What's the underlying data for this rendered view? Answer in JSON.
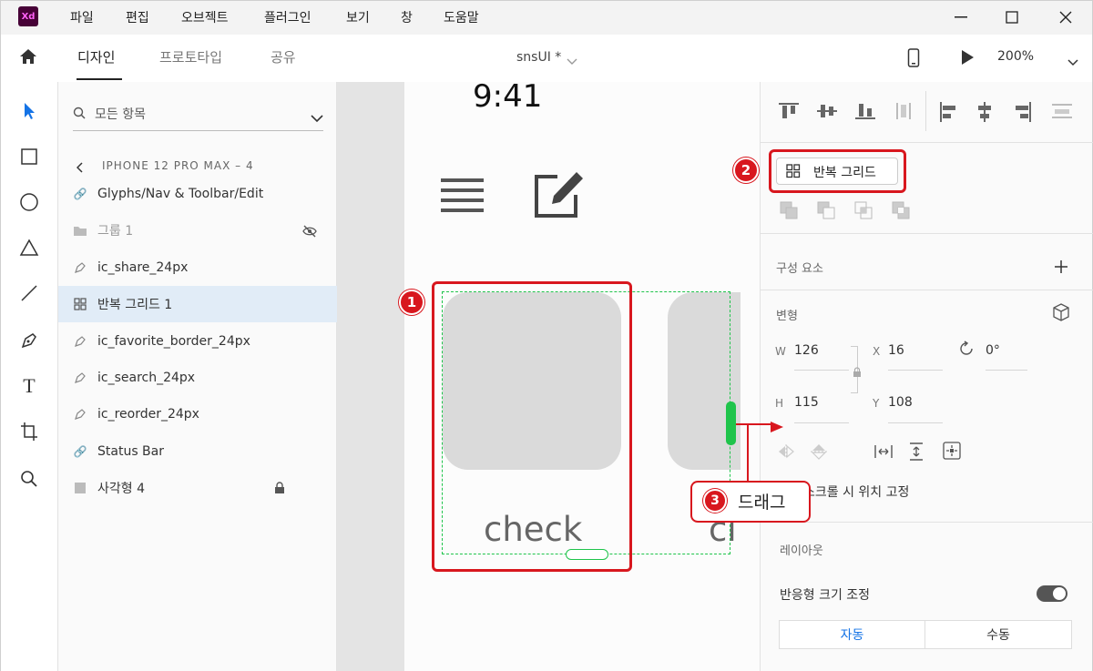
{
  "app": {
    "logo": "Xd"
  },
  "menu": [
    "파일",
    "편집",
    "오브젝트",
    "플러그인",
    "보기",
    "창",
    "도움말"
  ],
  "toolbar": {
    "tabs": [
      "디자인",
      "프로토타입",
      "공유"
    ],
    "filename": "snsUI *",
    "zoom": "200%"
  },
  "layers": {
    "search_placeholder": "모든 항목",
    "breadcrumb": "IPHONE 12 PRO MAX – 4",
    "items": [
      {
        "label": "Glyphs/Nav & Toolbar/Edit",
        "icon": "link-icon"
      },
      {
        "label": "그룹 1",
        "icon": "folder-icon"
      },
      {
        "label": "ic_share_24px",
        "icon": "pen-path-icon"
      },
      {
        "label": "반복 그리드 1",
        "icon": "repeat-grid-icon"
      },
      {
        "label": "ic_favorite_border_24px",
        "icon": "pen-path-icon"
      },
      {
        "label": "ic_search_24px",
        "icon": "pen-path-icon"
      },
      {
        "label": "ic_reorder_24px",
        "icon": "pen-path-icon"
      },
      {
        "label": "Status Bar",
        "icon": "link-icon"
      },
      {
        "label": "사각형 4",
        "icon": "rectangle-icon"
      }
    ]
  },
  "canvas": {
    "time": "9:41",
    "card_text": "check",
    "card_text_partial": "cl"
  },
  "props": {
    "repeat_grid_button": "반복 그리드",
    "components_label": "구성 요소",
    "transform_label": "변형",
    "w_label": "W",
    "w": "126",
    "x_label": "X",
    "x": "16",
    "rotation": "0°",
    "h_label": "H",
    "h": "115",
    "y_label": "Y",
    "y": "108",
    "fix_scroll": "스크롤 시 위치 고정",
    "layout_label": "레이아웃",
    "responsive_label": "반응형 크기 조정",
    "auto": "자동",
    "manual": "수동"
  },
  "callouts": {
    "one": "1",
    "two": "2",
    "three": "3",
    "drag": "드래그"
  },
  "colors": {
    "accent": "#d8171e",
    "selection": "#1fc44b",
    "highlight": "#e1ecf7",
    "active_blue": "#1473e6"
  }
}
